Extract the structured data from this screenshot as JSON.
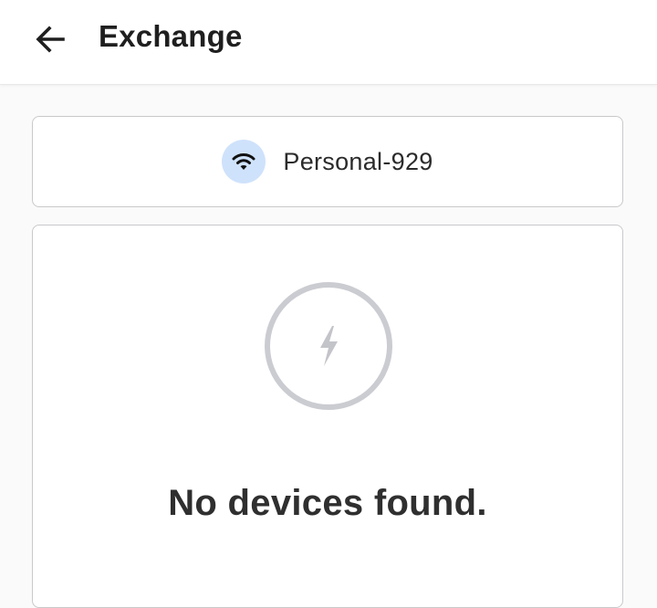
{
  "header": {
    "title": "Exchange",
    "back_icon": "arrow-left-icon"
  },
  "network": {
    "name": "Personal-929",
    "icon": "wifi-icon",
    "icon_bg_color": "#cfe2fb"
  },
  "devices": {
    "empty_icon": "lightning-bolt-icon",
    "empty_message": "No devices found."
  },
  "colors": {
    "background": "#fafafa",
    "card_border": "#c9c9cc",
    "ring": "#cbccd1"
  }
}
